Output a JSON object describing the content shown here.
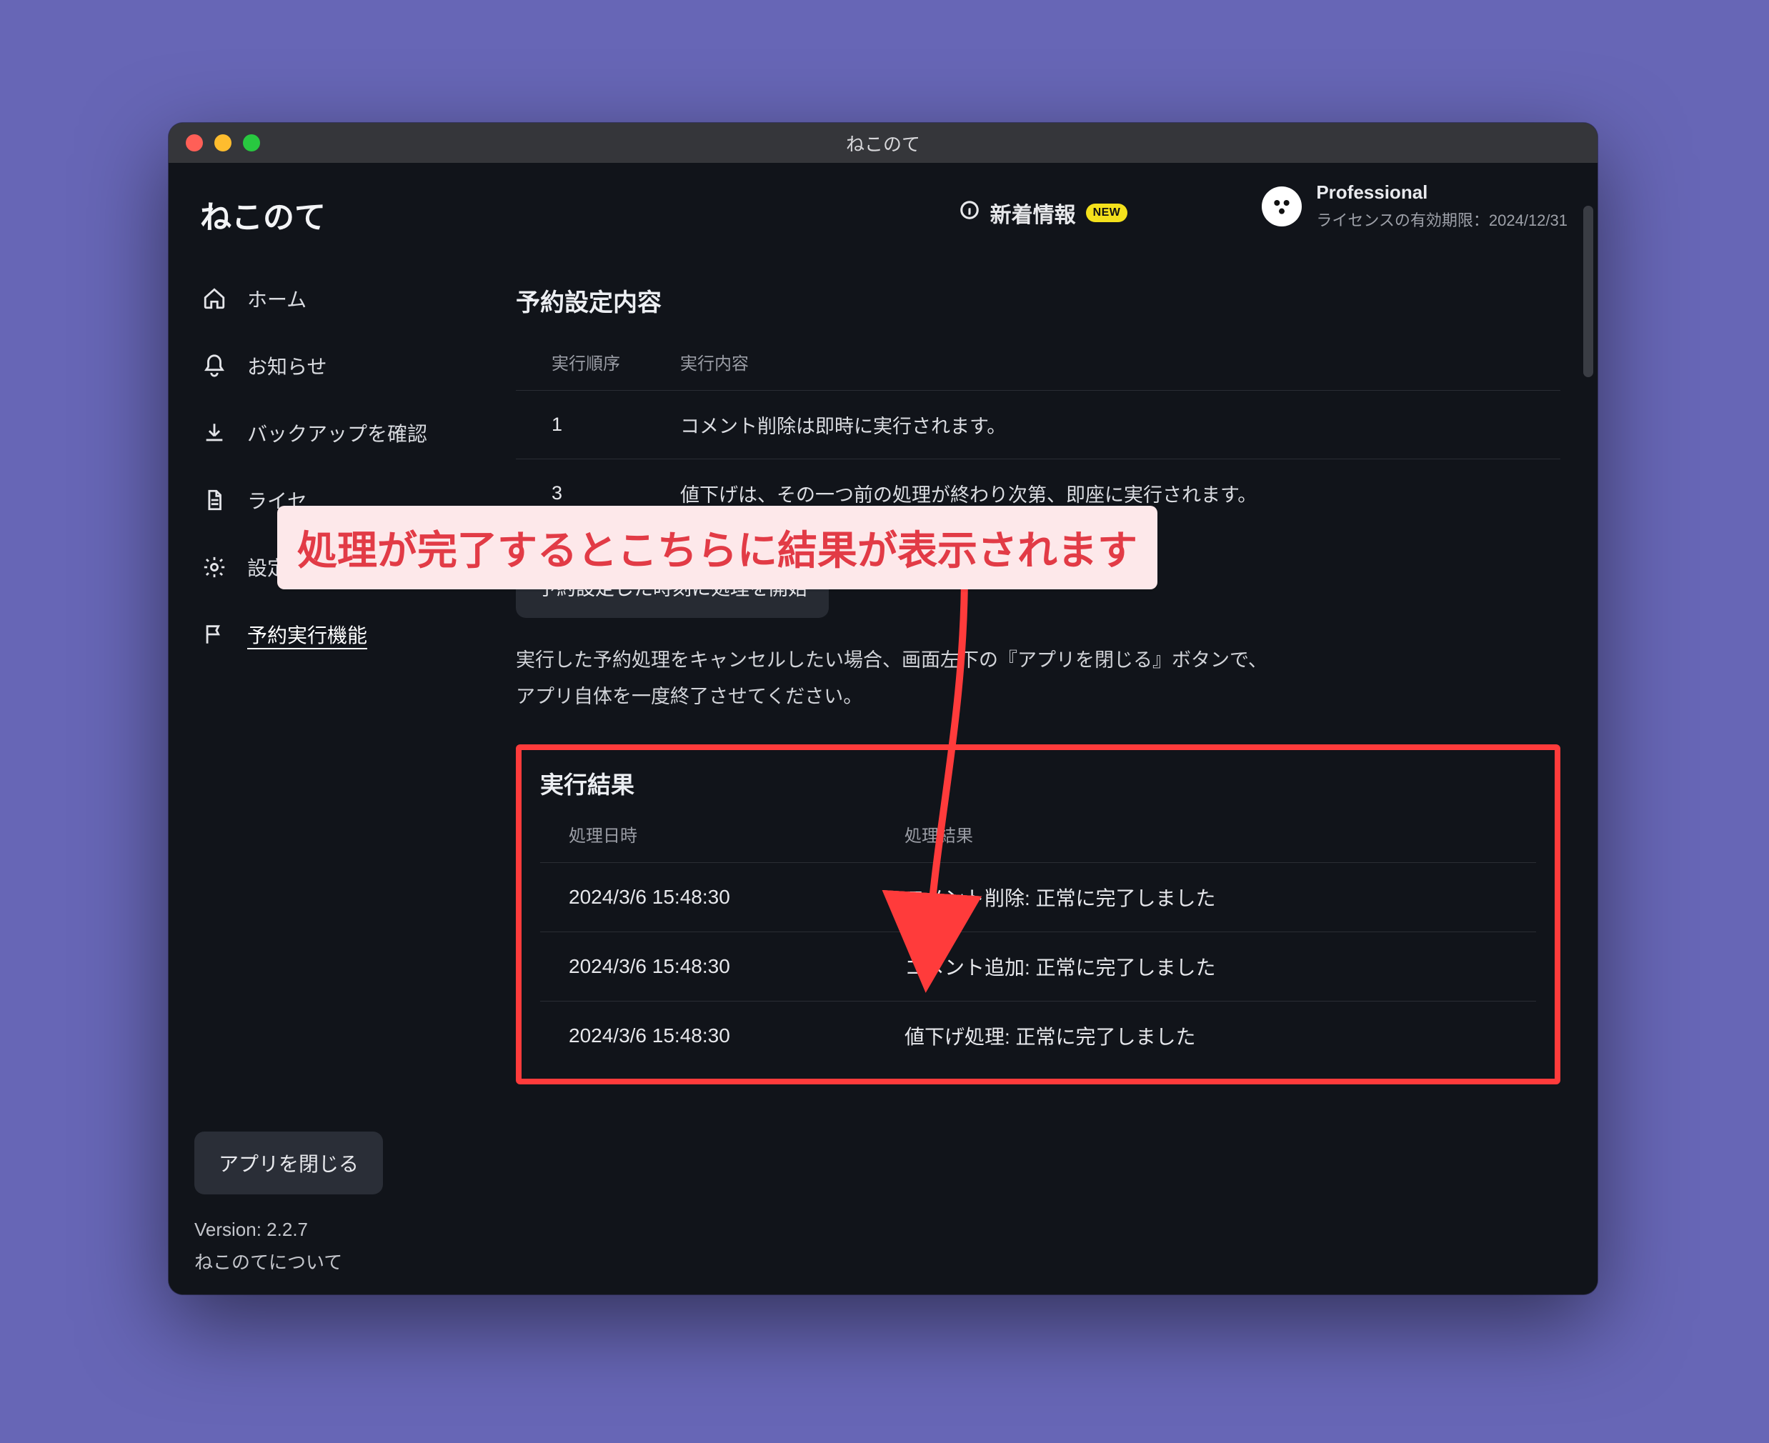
{
  "window_title": "ねこのて",
  "brand": "ねこのて",
  "sidebar": {
    "items": [
      {
        "label": "ホーム",
        "icon": "home-icon"
      },
      {
        "label": "お知らせ",
        "icon": "bell-icon"
      },
      {
        "label": "バックアップを確認",
        "icon": "download-icon"
      },
      {
        "label": "ライセ",
        "icon": "document-icon"
      },
      {
        "label": "設定とサポート",
        "icon": "gear-icon"
      },
      {
        "label": "予約実行機能",
        "icon": "flag-icon"
      }
    ],
    "active_index": 5,
    "close_app_label": "アプリを閉じる",
    "version_label": "Version: 2.2.7",
    "about_label": "ねこのてについて"
  },
  "topbar": {
    "news_label": "新着情報",
    "new_badge": "NEW"
  },
  "license": {
    "plan": "Professional",
    "expiry": "ライセンスの有効期限：2024/12/31"
  },
  "schedule": {
    "title": "予約設定内容",
    "headers": {
      "order": "実行順序",
      "content": "実行内容"
    },
    "rows": [
      {
        "order": "1",
        "content": "コメント削除は即時に実行されます。"
      },
      {
        "order": "3",
        "content": "値下げは、その一つ前の処理が終わり次第、即座に実行されます。"
      }
    ],
    "start_button": "予約設定した時刻に処理を開始",
    "hint_line1": "実行した予約処理をキャンセルしたい場合、画面左下の『アプリを閉じる』ボタンで、",
    "hint_line2": "アプリ自体を一度終了させてください。"
  },
  "results": {
    "title": "実行結果",
    "headers": {
      "date": "処理日時",
      "result": "処理結果"
    },
    "rows": [
      {
        "date": "2024/3/6 15:48:30",
        "result": "コメント削除: 正常に完了しました"
      },
      {
        "date": "2024/3/6 15:48:30",
        "result": "コメント追加: 正常に完了しました"
      },
      {
        "date": "2024/3/6 15:48:30",
        "result": "値下げ処理: 正常に完了しました"
      }
    ]
  },
  "annotation": {
    "callout": "処理が完了するとこちらに結果が表示されます"
  }
}
